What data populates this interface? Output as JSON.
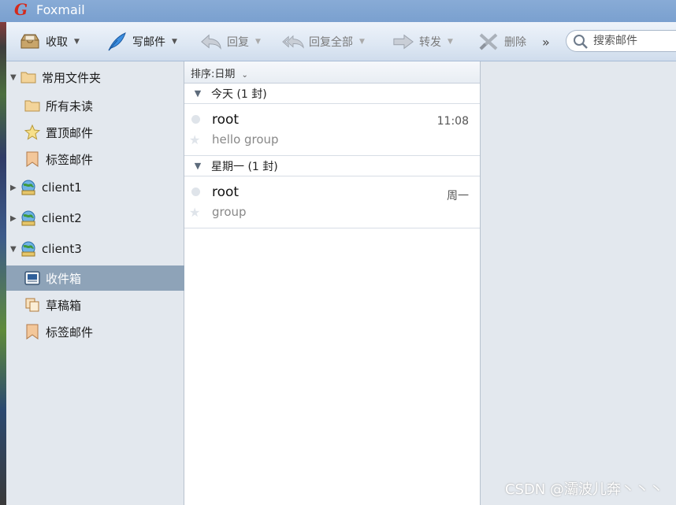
{
  "window": {
    "title": "Foxmail"
  },
  "toolbar": {
    "receive": "收取",
    "compose": "写邮件",
    "reply": "回复",
    "reply_all": "回复全部",
    "forward": "转发",
    "delete": "删除",
    "more": "»",
    "search_placeholder": "搜索邮件"
  },
  "sidebar": {
    "common_folder": "常用文件夹",
    "all_unread": "所有未读",
    "pinned": "置顶邮件",
    "tagged": "标签邮件",
    "accounts": [
      "client1",
      "client2",
      "client3"
    ],
    "inbox": "收件箱",
    "drafts": "草稿箱",
    "tagged2": "标签邮件"
  },
  "list": {
    "sort_label": "排序:日期",
    "groups": [
      {
        "header": "今天 (1 封)",
        "mails": [
          {
            "sender": "root",
            "subject": "hello group",
            "time": "11:08"
          }
        ]
      },
      {
        "header": "星期一 (1 封)",
        "mails": [
          {
            "sender": "root",
            "subject": "group",
            "time": "周一"
          }
        ]
      }
    ]
  },
  "watermark": "CSDN @灞波儿奔丶丶丶",
  "colors": {
    "accent": "#8ea3b8",
    "title_bar": "#7aa0cf"
  }
}
